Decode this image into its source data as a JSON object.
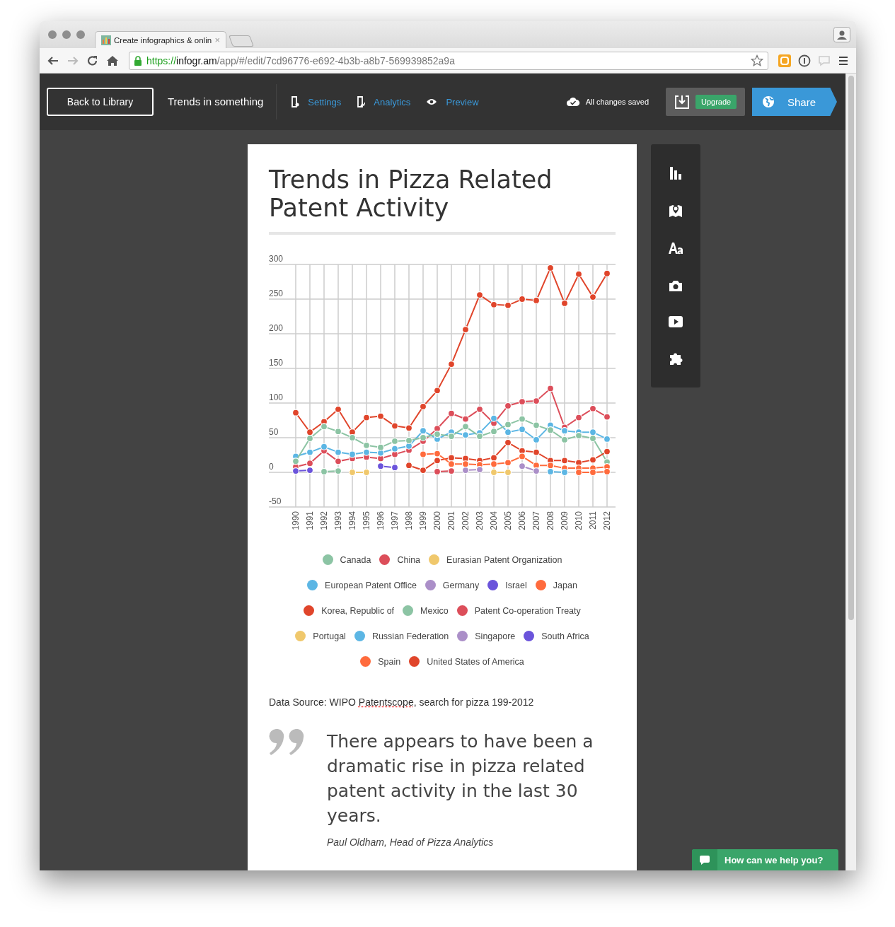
{
  "browser": {
    "tab_title": "Create infographics & onlin",
    "tab_close": "×",
    "url_scheme": "https://",
    "url_host": "infogr.am",
    "url_path": "/app/#/edit/7cd96776-e692-4b3b-a8b7-569939852a9a"
  },
  "header": {
    "back_button": "Back to Library",
    "project_title": "Trends in something",
    "nav": [
      {
        "kind": "settings",
        "label": "Settings"
      },
      {
        "kind": "analytics",
        "label": "Analytics"
      },
      {
        "kind": "preview",
        "label": "Preview"
      }
    ],
    "save_status": "All changes saved",
    "upgrade": "Upgrade",
    "share": "Share"
  },
  "infographic": {
    "title": "Trends in Pizza Related Patent Activity",
    "chart_data": {
      "type": "line",
      "categories": [
        "1990",
        "1991",
        "1992",
        "1993",
        "1994",
        "1995",
        "1996",
        "1997",
        "1998",
        "1999",
        "2000",
        "2001",
        "2002",
        "2003",
        "2004",
        "2005",
        "2006",
        "2007",
        "2008",
        "2009",
        "2010",
        "2011",
        "2012"
      ],
      "grid": true,
      "ylim": [
        -50,
        300
      ],
      "yticks": [
        -50,
        0,
        50,
        100,
        150,
        200,
        250,
        300
      ],
      "series": [
        {
          "name": "Canada",
          "color": "#8cc4a4",
          "marker": "circle",
          "values": [
            16,
            49,
            66,
            59,
            50,
            39,
            36,
            45,
            46,
            50,
            55,
            52,
            66,
            52,
            59,
            69,
            77,
            68,
            61,
            47,
            53,
            49,
            15
          ]
        },
        {
          "name": "China",
          "color": "#dc4e5a",
          "marker": "circle",
          "values": [
            8,
            13,
            31,
            16,
            20,
            22,
            20,
            26,
            32,
            45,
            63,
            85,
            77,
            91,
            71,
            96,
            102,
            103,
            121,
            65,
            79,
            92,
            80
          ]
        },
        {
          "name": "Eurasian Patent Organization",
          "color": "#f0c86c",
          "marker": "circle",
          "values": [
            null,
            null,
            null,
            null,
            null,
            null,
            null,
            null,
            null,
            null,
            null,
            null,
            null,
            null,
            0,
            0,
            null,
            null,
            null,
            null,
            null,
            null,
            null
          ]
        },
        {
          "name": "European Patent Office",
          "color": "#5cb6e4",
          "marker": "circle",
          "values": [
            23,
            29,
            37,
            29,
            26,
            29,
            28,
            34,
            38,
            60,
            48,
            58,
            54,
            57,
            78,
            58,
            62,
            47,
            68,
            60,
            58,
            58,
            48
          ]
        },
        {
          "name": "Germany",
          "color": "#ab8fc8",
          "marker": "circle",
          "values": [
            null,
            null,
            null,
            null,
            null,
            null,
            null,
            null,
            null,
            null,
            null,
            null,
            null,
            null,
            null,
            null,
            9,
            2,
            null,
            null,
            null,
            null,
            null
          ]
        },
        {
          "name": "Israel",
          "color": "#6b54db",
          "marker": "circle",
          "values": [
            2,
            3,
            null,
            null,
            null,
            null,
            null,
            null,
            null,
            null,
            null,
            null,
            null,
            null,
            null,
            null,
            null,
            null,
            null,
            null,
            null,
            null,
            null
          ]
        },
        {
          "name": "Japan",
          "color": "#ff6b3d",
          "marker": "circle",
          "values": [
            null,
            null,
            null,
            null,
            null,
            null,
            null,
            null,
            null,
            26,
            27,
            12,
            12,
            11,
            12,
            14,
            23,
            10,
            10,
            6,
            6,
            6,
            8
          ]
        },
        {
          "name": "Korea, Republic of",
          "color": "#e0452b",
          "marker": "circle",
          "values": [
            null,
            null,
            null,
            null,
            null,
            null,
            null,
            null,
            10,
            3,
            17,
            21,
            20,
            17,
            21,
            43,
            31,
            29,
            17,
            17,
            14,
            18,
            30
          ]
        },
        {
          "name": "Mexico",
          "color": "#8cc4a4",
          "marker": "circle",
          "values": [
            null,
            null,
            1,
            2,
            null,
            null,
            null,
            null,
            null,
            null,
            null,
            null,
            null,
            null,
            null,
            null,
            null,
            null,
            null,
            null,
            null,
            null,
            null
          ]
        },
        {
          "name": "Patent Co-operation Treaty",
          "color": "#dc4e5a",
          "marker": "circle",
          "values": [
            null,
            null,
            null,
            null,
            null,
            null,
            null,
            null,
            null,
            null,
            1,
            2,
            null,
            null,
            null,
            null,
            null,
            null,
            null,
            null,
            null,
            null,
            null
          ]
        },
        {
          "name": "Portugal",
          "color": "#f0c86c",
          "marker": "circle",
          "values": [
            null,
            null,
            null,
            null,
            0,
            0,
            null,
            null,
            null,
            null,
            null,
            null,
            null,
            null,
            null,
            null,
            null,
            null,
            null,
            null,
            null,
            null,
            null
          ]
        },
        {
          "name": "Russian Federation",
          "color": "#5cb6e4",
          "marker": "circle",
          "values": [
            null,
            null,
            null,
            null,
            null,
            null,
            null,
            null,
            null,
            null,
            null,
            null,
            null,
            null,
            null,
            null,
            null,
            null,
            1,
            0,
            null,
            null,
            null
          ]
        },
        {
          "name": "Singapore",
          "color": "#ab8fc8",
          "marker": "circle",
          "values": [
            null,
            null,
            null,
            null,
            null,
            null,
            null,
            null,
            null,
            null,
            null,
            null,
            3,
            4,
            null,
            null,
            null,
            null,
            null,
            null,
            null,
            null,
            null
          ]
        },
        {
          "name": "South Africa",
          "color": "#6b54db",
          "marker": "circle",
          "values": [
            null,
            null,
            null,
            null,
            null,
            null,
            9,
            7,
            null,
            null,
            null,
            null,
            null,
            null,
            null,
            null,
            null,
            null,
            null,
            null,
            null,
            null,
            null
          ]
        },
        {
          "name": "Spain",
          "color": "#ff6b3d",
          "marker": "circle",
          "values": [
            null,
            null,
            null,
            null,
            null,
            null,
            null,
            null,
            null,
            null,
            null,
            null,
            null,
            null,
            null,
            null,
            null,
            null,
            null,
            null,
            0,
            0,
            1
          ]
        },
        {
          "name": "United States of America",
          "color": "#e0452b",
          "marker": "circle",
          "values": [
            86,
            58,
            73,
            91,
            58,
            79,
            81,
            67,
            64,
            95,
            118,
            156,
            206,
            256,
            242,
            241,
            250,
            248,
            295,
            244,
            286,
            253,
            287
          ]
        }
      ]
    },
    "source": {
      "before": "Data Source: WIPO ",
      "flagged_word": "Patentscope",
      "after": ", search for pizza 199-2012"
    },
    "quote": {
      "text": "There appears to have been a dramatic rise in pizza related patent activity in the last 30 years.",
      "author": "Paul Oldham, Head of Pizza Analytics"
    }
  },
  "chat": {
    "label": "How can we help you?"
  }
}
